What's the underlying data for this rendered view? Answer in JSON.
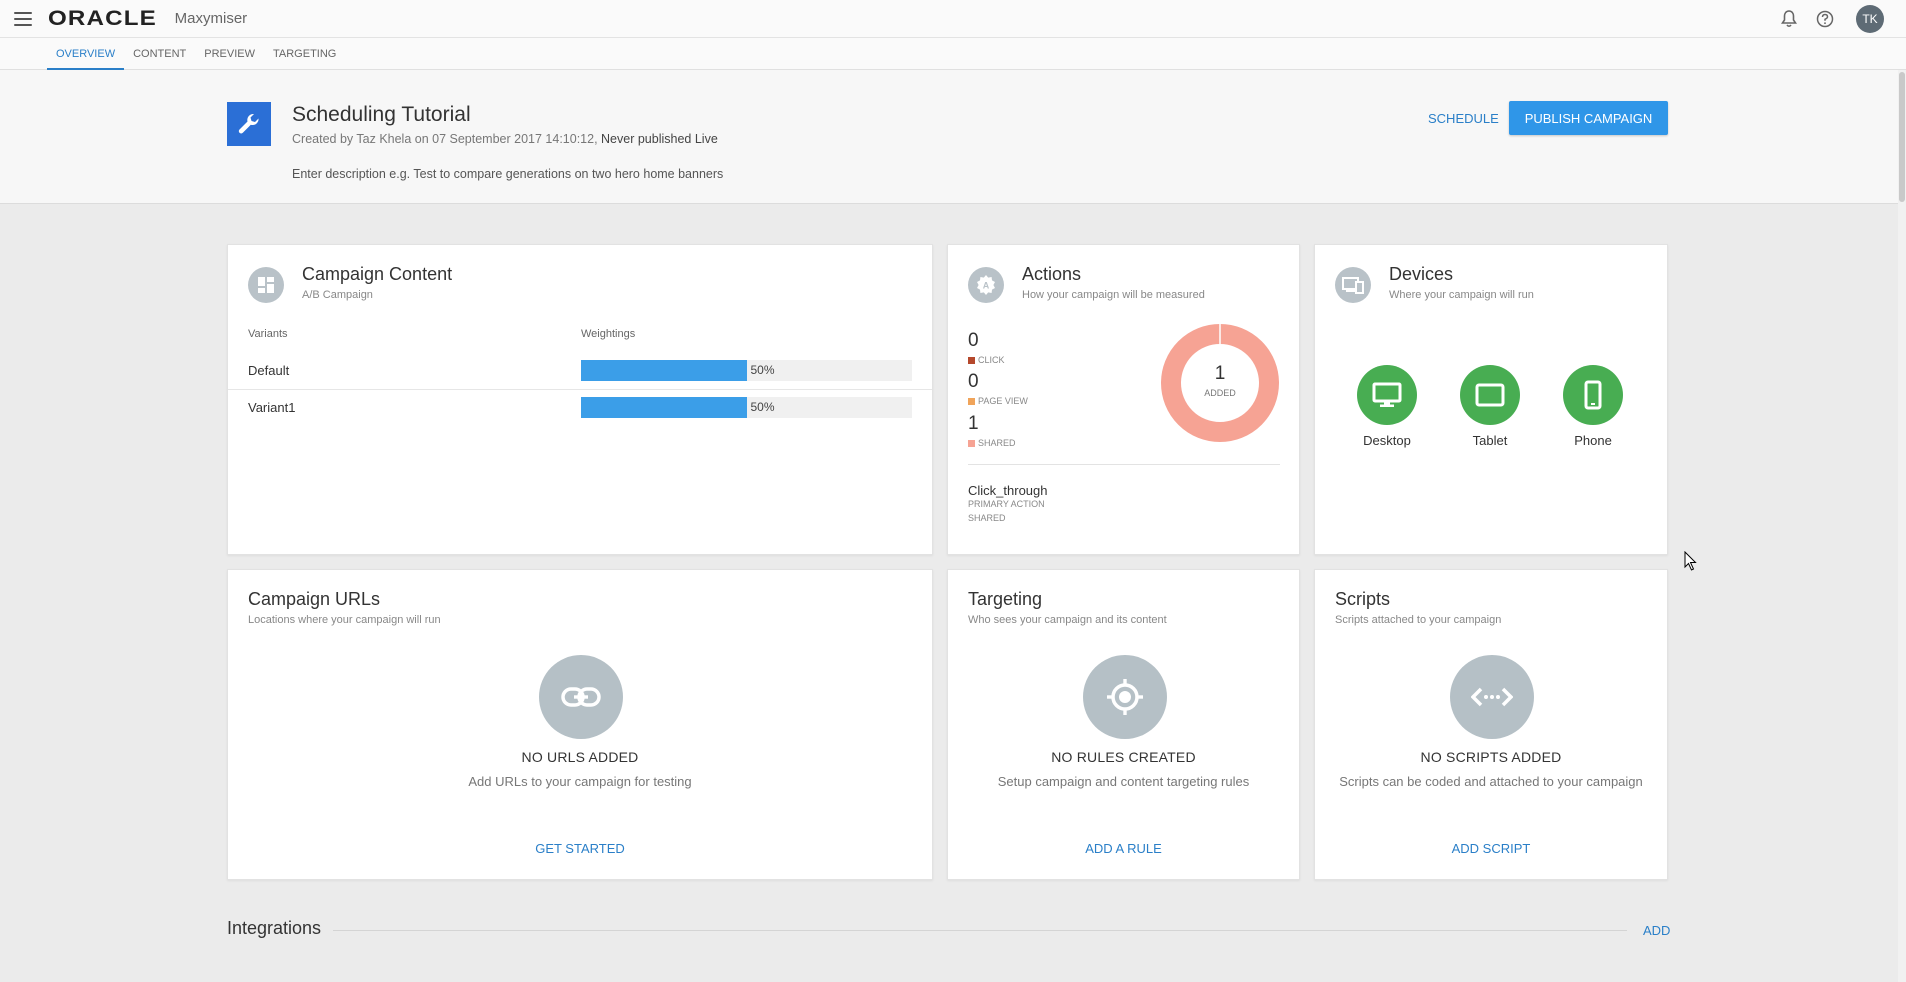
{
  "app": {
    "logo": "ORACLE",
    "product": "Maxymiser",
    "avatar_initials": "TK"
  },
  "tabs": [
    {
      "label": "OVERVIEW",
      "active": true
    },
    {
      "label": "CONTENT",
      "active": false
    },
    {
      "label": "PREVIEW",
      "active": false
    },
    {
      "label": "TARGETING",
      "active": false
    }
  ],
  "campaign": {
    "title": "Scheduling Tutorial",
    "created_prefix": "Created by Taz Khela on 07 September 2017 14:10:12,",
    "status": "Never published Live",
    "description_placeholder": "Enter description e.g. Test to compare generations on two hero home banners",
    "schedule_label": "SCHEDULE",
    "publish_label": "PUBLISH CAMPAIGN",
    "icon": "wrench-icon",
    "accent": "#2b6fd6"
  },
  "content_card": {
    "title": "Campaign Content",
    "subtitle": "A/B Campaign",
    "col_variants": "Variants",
    "col_weightings": "Weightings",
    "variants": [
      {
        "name": "Default",
        "weight": 50,
        "weight_label": "50%"
      },
      {
        "name": "Variant1",
        "weight": 50,
        "weight_label": "50%"
      }
    ]
  },
  "actions_card": {
    "title": "Actions",
    "subtitle": "How your campaign will be measured",
    "counts": [
      {
        "value": "0",
        "label": "CLICK",
        "color": "#b5482c"
      },
      {
        "value": "0",
        "label": "PAGE VIEW",
        "color": "#f0a45a"
      },
      {
        "value": "1",
        "label": "SHARED",
        "color": "#f6a394"
      }
    ],
    "donut_value": "1",
    "donut_label": "ADDED",
    "donut_color": "#f6a394",
    "primary_name": "Click_through",
    "primary_label": "PRIMARY ACTION",
    "primary_type": "SHARED"
  },
  "devices_card": {
    "title": "Devices",
    "subtitle": "Where your campaign will run",
    "devices": [
      {
        "label": "Desktop",
        "icon": "desktop-icon"
      },
      {
        "label": "Tablet",
        "icon": "tablet-icon"
      },
      {
        "label": "Phone",
        "icon": "phone-icon"
      }
    ],
    "device_color": "#48ad52"
  },
  "urls_card": {
    "title": "Campaign URLs",
    "subtitle": "Locations where your campaign will run",
    "empty_title": "NO URLS ADDED",
    "empty_desc": "Add URLs to your campaign for testing",
    "action": "GET STARTED"
  },
  "targeting_card": {
    "title": "Targeting",
    "subtitle": "Who sees your campaign and its content",
    "empty_title": "NO RULES CREATED",
    "empty_desc": "Setup campaign and content targeting rules",
    "action": "ADD A RULE"
  },
  "scripts_card": {
    "title": "Scripts",
    "subtitle": "Scripts attached to your campaign",
    "empty_title": "NO SCRIPTS ADDED",
    "empty_desc": "Scripts can be coded and attached to your campaign",
    "action": "ADD SCRIPT"
  },
  "integrations": {
    "title": "Integrations",
    "action": "ADD"
  }
}
